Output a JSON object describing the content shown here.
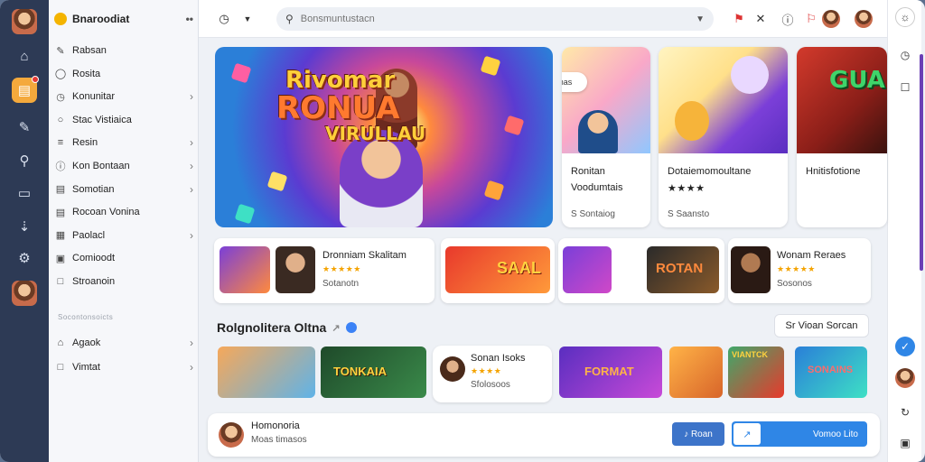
{
  "app": {
    "title": "Bnaroodiat",
    "more": "••"
  },
  "search": {
    "placeholder": "Bonsmuntustacn"
  },
  "sidebar": {
    "items": [
      {
        "label": "Rabsan",
        "icon": "pencil-icon"
      },
      {
        "label": "Rosita",
        "icon": "chat-icon"
      },
      {
        "label": "Konunitar",
        "icon": "clock-icon",
        "chevron": true
      },
      {
        "label": "Stac Vistiaica",
        "icon": "bubble-icon"
      },
      {
        "label": "Resin",
        "icon": "list-icon",
        "chevron": true
      },
      {
        "label": "Kon Bontaan",
        "icon": "info-icon",
        "chevron": true
      },
      {
        "label": "Somotian",
        "icon": "document-icon",
        "chevron": true
      },
      {
        "label": "Rocoan Vonina",
        "icon": "document-icon"
      },
      {
        "label": "Paolacl",
        "icon": "table-icon",
        "chevron": true
      },
      {
        "label": "Comioodt",
        "icon": "grid-icon"
      },
      {
        "label": "Stroanoin",
        "icon": "box-icon"
      }
    ],
    "section_label": "Socontonsoicts",
    "items2": [
      {
        "label": "Agaok",
        "icon": "home-icon",
        "chevron": true
      },
      {
        "label": "Vimtat",
        "icon": "box-icon",
        "chevron": true
      }
    ]
  },
  "hero": {
    "line1": "Rivomar",
    "line2": "RONUA",
    "line3": "VIRULLAU"
  },
  "featured": [
    {
      "title": "Ronitan",
      "subtitle": "Voodumtais",
      "meta": "S Sontaiog",
      "bubble": "Suunas"
    },
    {
      "title": "Dotaiemomoultane",
      "stars": "★★★★",
      "meta": "S Saansto"
    },
    {
      "title": "Hnitisfotione",
      "banner": "GUAN PUR"
    }
  ],
  "row": [
    {
      "title": "Dronniam Skalitam",
      "stars": "★★★★★",
      "meta": "Sotanotn"
    },
    {
      "banner": "SAAL"
    },
    {
      "banner": "ROTAN"
    },
    {
      "title": "Wonam Reraes",
      "stars": "★★★★★",
      "meta": "Sosonos"
    }
  ],
  "section": {
    "title": "Rolgnolitera Oltna",
    "tag": "↗",
    "see_all": "Sr Vioan Sorcan"
  },
  "row2": [
    {
      "banner": "TONKAIA"
    },
    {
      "title": "Sonan Isoks",
      "stars": "★★★★",
      "meta": "Sfolosoos"
    },
    {
      "banner": "FORMAT"
    },
    {
      "banner": "VIANTCK"
    },
    {
      "banner": "SONAINS"
    }
  ],
  "bottom": {
    "name": "Homonoria",
    "sub": "Moas timasos",
    "btn1": "Roan",
    "btn2": "Vomoo Lito"
  },
  "colors": {
    "rail": "#2d3a55",
    "accent": "#f4a93c",
    "primary": "#2f86e6"
  }
}
